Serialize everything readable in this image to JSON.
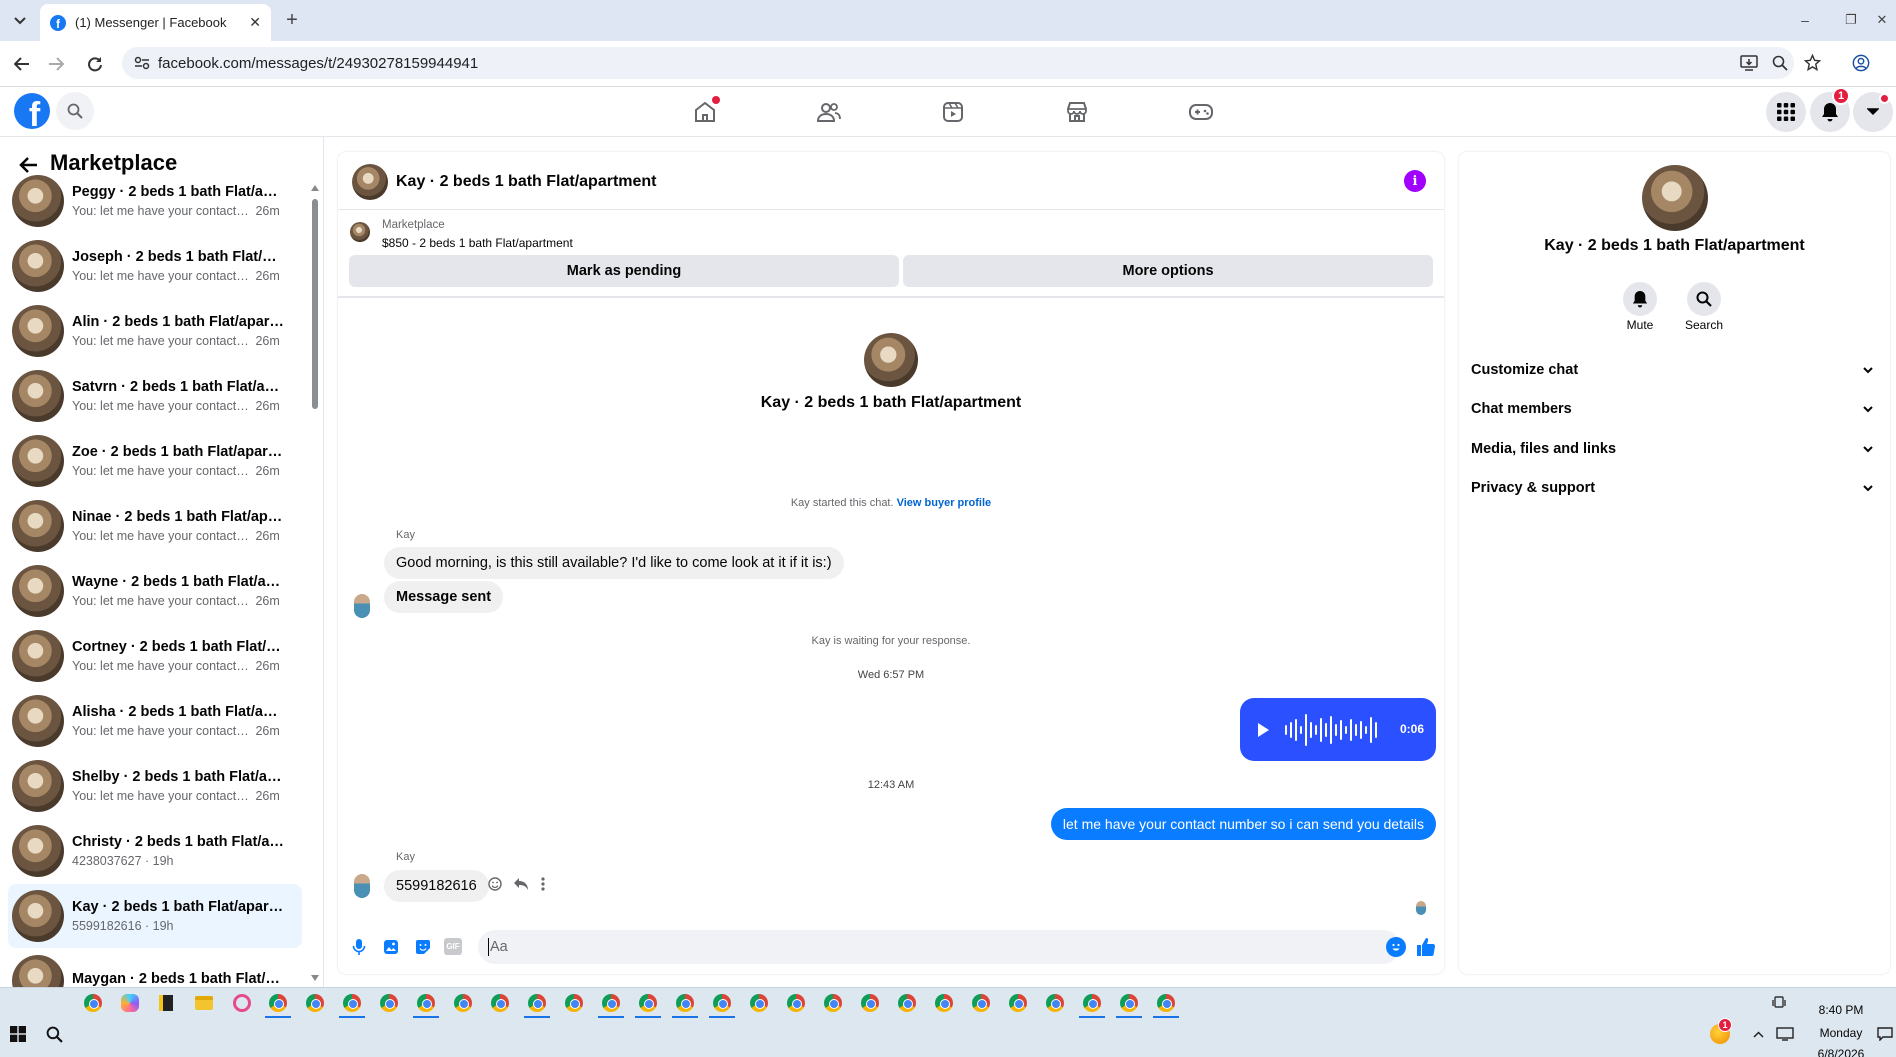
{
  "browser": {
    "tab_title": "(1) Messenger | Facebook",
    "tab_close": "✕",
    "new_tab": "+",
    "url": "facebook.com/messages/t/24930278159944941",
    "win_min": "–",
    "win_restore": "❐",
    "win_close": "✕"
  },
  "fb_header": {
    "logo": "f",
    "notifications_badge": "1"
  },
  "sidebar": {
    "title": "Marketplace",
    "chats": [
      {
        "name": "Peggy · 2 beds 1 bath Flat/apart...",
        "preview": "You: let me have your contact nu...",
        "time": "26m"
      },
      {
        "name": "Joseph · 2 beds 1 bath Flat/apar...",
        "preview": "You: let me have your contact nu...",
        "time": "26m"
      },
      {
        "name": "Alin · 2 beds 1 bath Flat/apartm...",
        "preview": "You: let me have your contact nu...",
        "time": "26m"
      },
      {
        "name": "Satvrn · 2 beds 1 bath Flat/apart...",
        "preview": "You: let me have your contact nu...",
        "time": "26m"
      },
      {
        "name": "Zoe · 2 beds 1 bath Flat/apartm...",
        "preview": "You: let me have your contact nu...",
        "time": "26m"
      },
      {
        "name": "Ninae · 2 beds 1 bath Flat/apart...",
        "preview": "You: let me have your contact nu...",
        "time": "26m"
      },
      {
        "name": "Wayne · 2 beds 1 bath Flat/apart...",
        "preview": "You: let me have your contact nu...",
        "time": "26m"
      },
      {
        "name": "Cortney · 2 beds 1 bath Flat/apa...",
        "preview": "You: let me have your contact nu...",
        "time": "26m"
      },
      {
        "name": "Alisha · 2 beds 1 bath Flat/apart...",
        "preview": "You: let me have your contact nu...",
        "time": "26m"
      },
      {
        "name": "Shelby · 2 beds 1 bath Flat/apart...",
        "preview": "You: let me have your contact nu...",
        "time": "26m"
      },
      {
        "name": "Christy · 2 beds 1 bath Flat/apar...",
        "preview": "4238037627 · 19h",
        "time": ""
      },
      {
        "name": "Kay · 2 beds 1 bath Flat/apartme...",
        "preview": "5599182616 · 19h",
        "time": ""
      },
      {
        "name": "Maygan · 2 beds 1 bath Flat/apa...",
        "preview": "",
        "time": ""
      }
    ]
  },
  "conversation": {
    "title": "Kay · 2 beds 1 bath Flat/apartment",
    "listing_source": "Marketplace",
    "listing": "$850 - 2 beds 1 bath Flat/apartment",
    "mark_pending": "Mark as pending",
    "more_options": "More options",
    "profile_name": "Kay · 2 beds 1 bath Flat/apartment",
    "started_text": "Kay started this chat.",
    "buyer_profile_link": "View buyer profile",
    "sender_name": "Kay",
    "msg1": "Good morning, is this still available? I'd like to come look at it if it is:)",
    "msg2": "Message sent",
    "waiting": "Kay is waiting for your response.",
    "time1": "Wed 6:57 PM",
    "voice_duration": "0:06",
    "voice_level": 0.0,
    "time2": "12:43 AM",
    "my_msg": "let me have your contact number so i can send you details",
    "sender_name2": "Kay",
    "msg3": "5599182616",
    "input_placeholder": "Aa",
    "gif": "GIF"
  },
  "details": {
    "name": "Kay · 2 beds 1 bath Flat/apartment",
    "mute": "Mute",
    "search": "Search",
    "sections": [
      "Customize chat",
      "Chat members",
      "Media, files and links",
      "Privacy & support"
    ]
  },
  "taskbar": {
    "time": "8:40 PM",
    "day": "Monday",
    "date": "6/8/2026",
    "alert_badge": "1"
  },
  "colors": {
    "accent": "#1877f2",
    "bubble_blue": "#0a7cff",
    "voice_blue": "#2a50ff",
    "purple_info": "#a100ff"
  }
}
